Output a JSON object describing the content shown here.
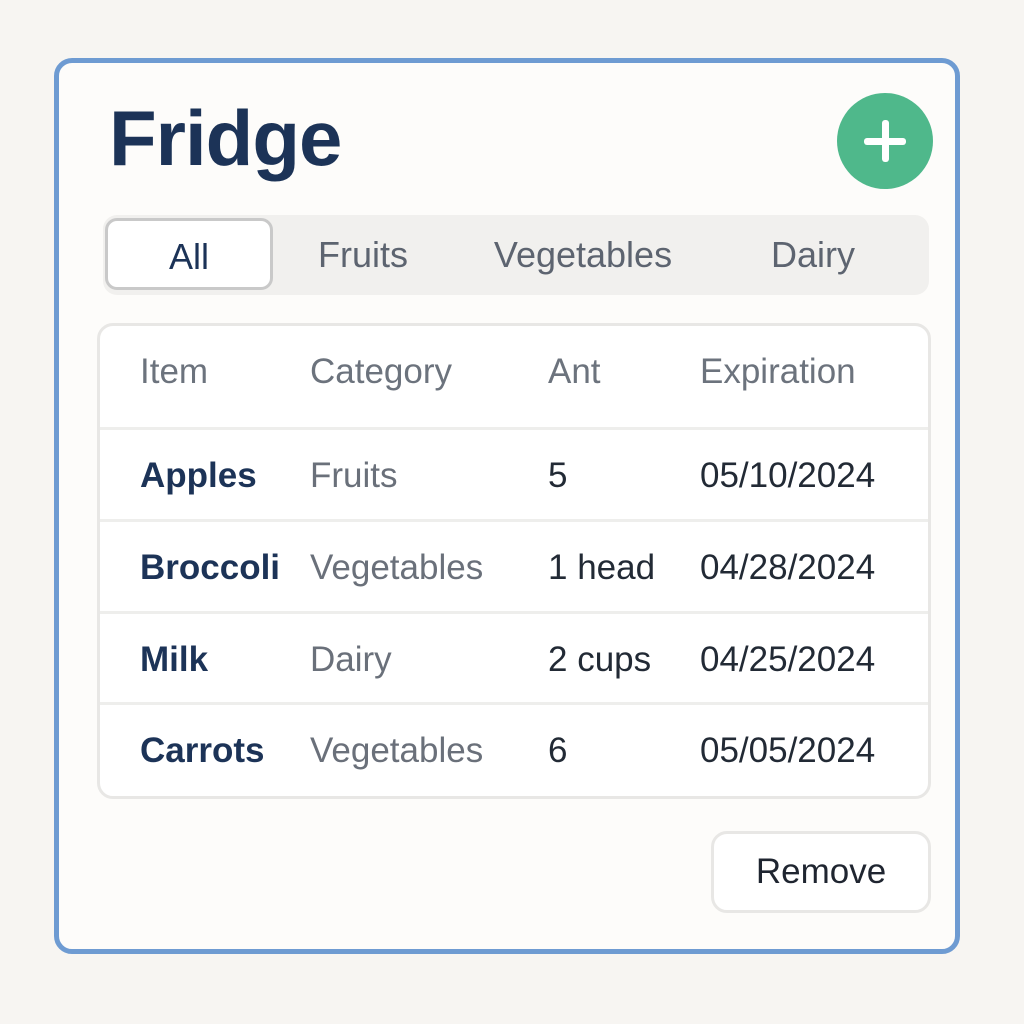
{
  "app": {
    "title": "Fridge"
  },
  "tabs": [
    {
      "label": "All",
      "active": true
    },
    {
      "label": "Fruits",
      "active": false
    },
    {
      "label": "Vegetables",
      "active": false
    },
    {
      "label": "Dairy",
      "active": false
    }
  ],
  "table": {
    "columns": [
      "Item",
      "Category",
      "Ant",
      "Expiration"
    ],
    "rows": [
      {
        "item": "Apples",
        "category": "Fruits",
        "amount": "5",
        "expiration": "05/10/2024"
      },
      {
        "item": "Broccoli",
        "category": "Vegetables",
        "amount": "1 head",
        "expiration": "04/28/2024"
      },
      {
        "item": "Milk",
        "category": "Dairy",
        "amount": "2 cups",
        "expiration": "04/25/2024"
      },
      {
        "item": "Carrots",
        "category": "Vegetables",
        "amount": "6",
        "expiration": "05/05/2024"
      }
    ]
  },
  "actions": {
    "add_icon": "plus-icon",
    "remove_label": "Remove"
  },
  "colors": {
    "accent_green": "#4fb88b",
    "frame_blue": "#6e9bd2",
    "title_navy": "#1c3357"
  }
}
